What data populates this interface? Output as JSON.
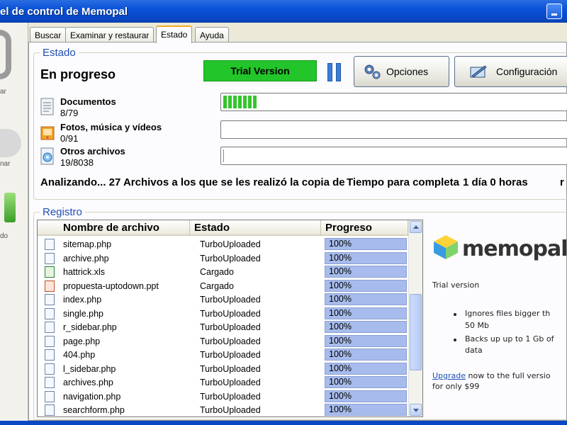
{
  "window": {
    "title": "el de control de Memopal"
  },
  "left_panel": {
    "labels": [
      "ar",
      "nar",
      "do"
    ]
  },
  "tabs": [
    {
      "label": "Buscar",
      "active": false
    },
    {
      "label": "Examinar y restaurar",
      "active": false
    },
    {
      "label": "Estado",
      "active": true
    },
    {
      "label": "Ayuda",
      "active": false
    }
  ],
  "estado": {
    "section_title": "Estado",
    "status": "En progreso",
    "trial_badge": "Trial Version",
    "buttons": {
      "options": "Opciones",
      "config": "Configuración"
    },
    "categories": [
      {
        "name": "Documentos",
        "count": "8/79",
        "progress": 0.101,
        "icon": "document-icon"
      },
      {
        "name": "Fotos, música y vídeos",
        "count": "0/91",
        "progress": 0.0,
        "icon": "media-icon"
      },
      {
        "name": "Otros archivos",
        "count": "19/8038",
        "progress": 0.0024,
        "icon": "other-files-icon"
      }
    ],
    "analysis_text": "Analizando... 27 Archivos a los que se les realizó la copia de",
    "time_label": "Tiempo para completar:",
    "time_value": "1 día 0 horas",
    "time_extra": "r"
  },
  "registro": {
    "section_title": "Registro",
    "columns": [
      "Nombre de archivo",
      "Estado",
      "Progreso"
    ],
    "rows": [
      {
        "name": "sitemap.php",
        "state": "TurboUploaded",
        "progress": "100%",
        "type": "php"
      },
      {
        "name": "archive.php",
        "state": "TurboUploaded",
        "progress": "100%",
        "type": "php"
      },
      {
        "name": "hattrick.xls",
        "state": "Cargado",
        "progress": "100%",
        "type": "xls"
      },
      {
        "name": "propuesta-uptodown.ppt",
        "state": "Cargado",
        "progress": "100%",
        "type": "ppt"
      },
      {
        "name": "index.php",
        "state": "TurboUploaded",
        "progress": "100%",
        "type": "php"
      },
      {
        "name": "single.php",
        "state": "TurboUploaded",
        "progress": "100%",
        "type": "php"
      },
      {
        "name": "r_sidebar.php",
        "state": "TurboUploaded",
        "progress": "100%",
        "type": "php"
      },
      {
        "name": "page.php",
        "state": "TurboUploaded",
        "progress": "100%",
        "type": "php"
      },
      {
        "name": "404.php",
        "state": "TurboUploaded",
        "progress": "100%",
        "type": "php"
      },
      {
        "name": "l_sidebar.php",
        "state": "TurboUploaded",
        "progress": "100%",
        "type": "php"
      },
      {
        "name": "archives.php",
        "state": "TurboUploaded",
        "progress": "100%",
        "type": "php"
      },
      {
        "name": "navigation.php",
        "state": "TurboUploaded",
        "progress": "100%",
        "type": "php"
      },
      {
        "name": "searchform.php",
        "state": "TurboUploaded",
        "progress": "100%",
        "type": "php"
      }
    ]
  },
  "ad": {
    "logo": "memopal",
    "trial": "Trial version",
    "bullet1_line1": "Ignores files bigger th",
    "bullet1_line2": "50 Mb",
    "bullet2_line1": "Backs up up to 1 Gb of",
    "bullet2_line2": "data",
    "upgrade_link": "Upgrade",
    "upgrade_rest": " now to the full versio",
    "upgrade_line2": "for only $99"
  },
  "colors": {
    "accent": "#1f4fb4",
    "trial_green": "#22c52a",
    "titlebar": "#0a52d8"
  }
}
